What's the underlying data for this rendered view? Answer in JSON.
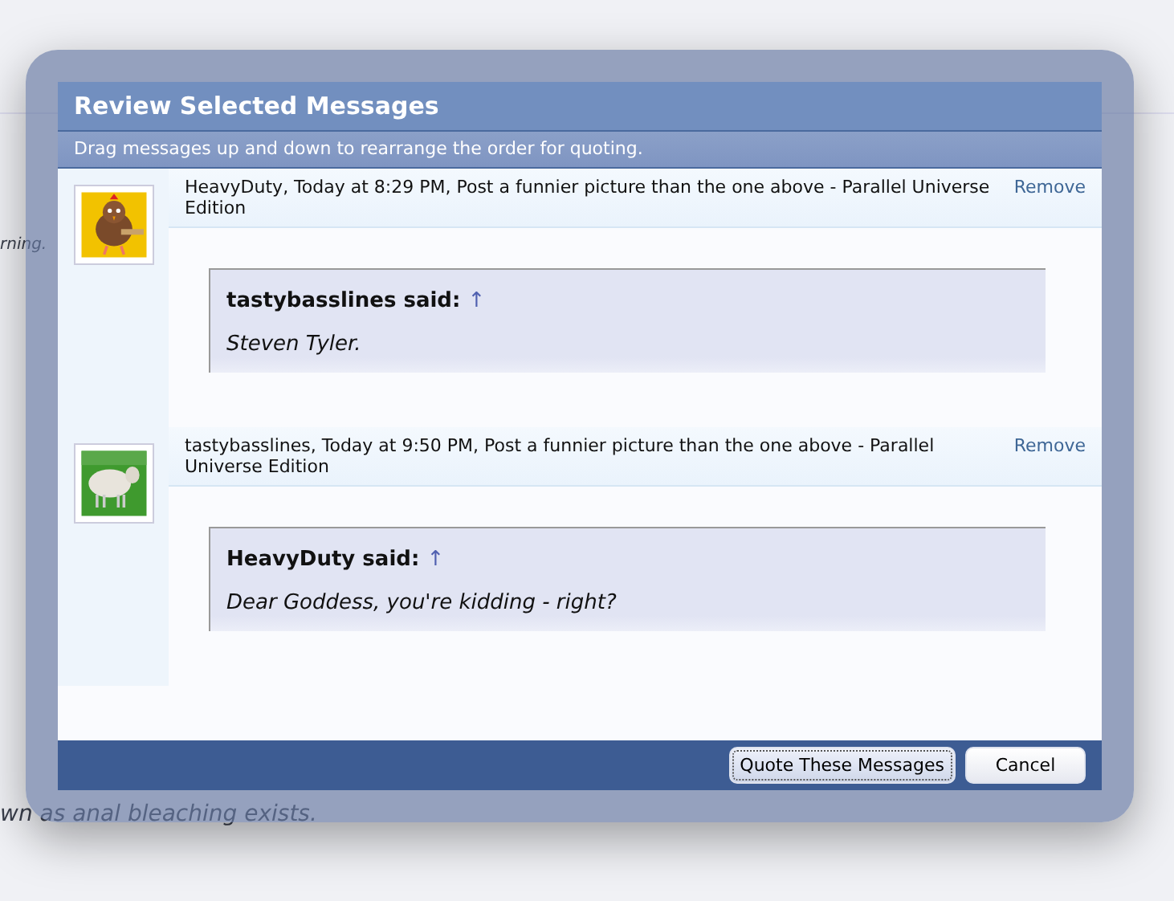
{
  "background": {
    "texts": [
      "rning.",
      "wn as anal bleaching exists."
    ]
  },
  "dialog": {
    "title": "Review Selected Messages",
    "subtitle": "Drag messages up and down to rearrange the order for quoting.",
    "messages": [
      {
        "header": "HeavyDuty, Today at 8:29 PM, Post a funnier picture than the one above - Parallel Universe Edition",
        "remove": "Remove",
        "kind": "chicken",
        "quote_author": "tastybasslines said:",
        "quote_arrow": "↑",
        "quote_text": "Steven Tyler."
      },
      {
        "header": "tastybasslines, Today at 9:50 PM, Post a funnier picture than the one above - Parallel Universe Edition",
        "remove": "Remove",
        "kind": "sheep",
        "quote_author": "HeavyDuty said:",
        "quote_arrow": "↑",
        "quote_text": "Dear Goddess, you're kidding - right?"
      }
    ],
    "buttons": [
      {
        "label": "Quote These Messages",
        "kind": "primary"
      },
      {
        "label": "Cancel",
        "kind": "secondary"
      }
    ]
  }
}
